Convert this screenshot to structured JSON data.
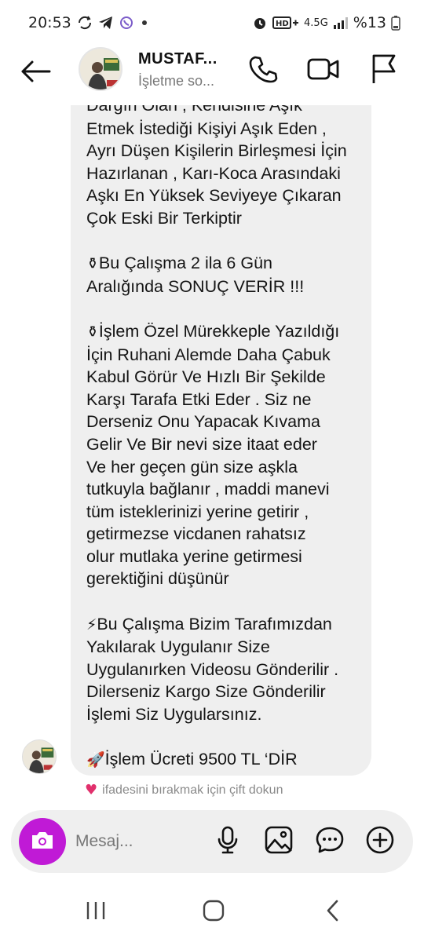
{
  "status_bar": {
    "time": "20:53",
    "network_small": "4.5G",
    "battery": "%13",
    "icons": [
      "sync-icon",
      "telegram-icon",
      "viber-icon",
      "dot-icon",
      "alarm-icon",
      "hd-voice-icon",
      "signal-icon",
      "battery-icon"
    ]
  },
  "header": {
    "name": "MUSTAF...",
    "subtitle": "İşletme so...",
    "icons": [
      "back-arrow-icon",
      "phone-icon",
      "video-icon",
      "flag-icon"
    ]
  },
  "message": {
    "paragraphs": [
      {
        "emoji": "",
        "text": "Dargın Olan , Kendisine Aşık\nEtmek İstediği Kişiyi Aşık Eden ,\nAyrı Düşen Kişilerin Birleşmesi İçin\nHazırlanan , Karı-Koca Arasındaki\nAşkı En Yüksek Seviyeye Çıkaran\nÇok Eski Bir Terkiptir"
      },
      {
        "emoji": "⚱",
        "text": "Bu Çalışma 2 ila 6 Gün\nAralığında  SONUÇ VERİR !!!"
      },
      {
        "emoji": "⚱",
        "text": "İşlem Özel Mürekkeple  Yazıldığı\nİçin Ruhani Alemde Daha Çabuk\nKabul Görür Ve Hızlı Bir Şekilde\nKarşı Tarafa Etki Eder . Siz ne\nDerseniz Onu Yapacak Kıvama\nGelir Ve Bir nevi size itaat eder\nVe her geçen gün size aşkla\ntutkuyla bağlanır , maddi manevi\ntüm isteklerinizi yerine getirir ,\ngetirmezse vicdanen rahatsız\nolur mutlaka yerine getirmesi\ngerektiğini düşünür"
      },
      {
        "emoji": "⚡",
        "text": "Bu Çalışma Bizim Tarafımızdan\nYakılarak Uygulanır Size\nUygulanırken Videosu Gönderilir .\nDilerseniz Kargo Size Gönderilir\nİşlemi Siz Uygularsınız."
      },
      {
        "emoji": "🚀",
        "text": "İşlem Ücreti 9500 TL ‘DİR"
      }
    ]
  },
  "reaction_hint": {
    "heart": "♥",
    "text": "ifadesini bırakmak için çift dokun"
  },
  "composer": {
    "placeholder": "Mesaj...",
    "icons": [
      "camera-icon",
      "microphone-icon",
      "gallery-icon",
      "sticker-icon",
      "plus-icon"
    ],
    "accent": "#c01ad6"
  },
  "navbar": {
    "icons": [
      "recent-apps-icon",
      "home-icon",
      "back-icon"
    ]
  }
}
